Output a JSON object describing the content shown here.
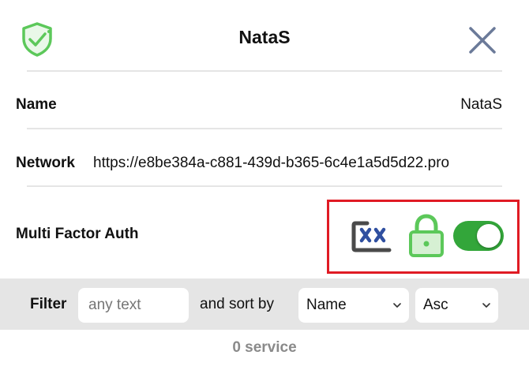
{
  "header": {
    "title": "NataS",
    "shield_icon": "shield-check-icon",
    "close_icon": "close-icon"
  },
  "details": {
    "name_label": "Name",
    "name_value": "NataS",
    "network_label": "Network",
    "network_value": "https://e8be384a-c881-439d-b365-6c4e1a5d5d22.pro",
    "mfa_label": "Multi Factor Auth",
    "mfa_icons": [
      "xx-icon",
      "lock-icon"
    ],
    "mfa_enabled": true
  },
  "filter": {
    "label": "Filter",
    "placeholder": "any text",
    "value": "",
    "sort_label": "and sort by",
    "sort_field": "Name",
    "sort_order": "Asc"
  },
  "status": {
    "count_text": "0 service"
  },
  "colors": {
    "accent_green": "#33a63a",
    "icon_green": "#5cc85a",
    "highlight_red": "#e01b24",
    "close_gray": "#6b7a99",
    "xx_blue": "#2f4fa0",
    "filter_bar_bg": "#e5e5e5",
    "count_text": "#8a8a8a"
  }
}
